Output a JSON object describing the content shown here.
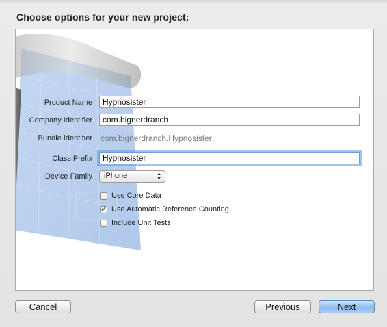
{
  "dialog": {
    "heading": "Choose options for your new project:"
  },
  "form": {
    "product_name": {
      "label": "Product Name",
      "value": "Hypnosister"
    },
    "company_identifier": {
      "label": "Company Identifier",
      "value": "com.bignerdranch"
    },
    "bundle_identifier": {
      "label": "Bundle Identifier",
      "value": "com.bignerdranch.Hypnosister"
    },
    "class_prefix": {
      "label": "Class Prefix",
      "value": "Hypnosister"
    },
    "device_family": {
      "label": "Device Family",
      "selected": "iPhone"
    },
    "options": [
      {
        "label": "Use Core Data",
        "checked": false
      },
      {
        "label": "Use Automatic Reference Counting",
        "checked": true
      },
      {
        "label": "Include Unit Tests",
        "checked": false
      }
    ]
  },
  "buttons": {
    "cancel": "Cancel",
    "previous": "Previous",
    "next": "Next"
  },
  "colors": {
    "accent": "#8fbbee",
    "blueprint": "#5b8fd6"
  }
}
